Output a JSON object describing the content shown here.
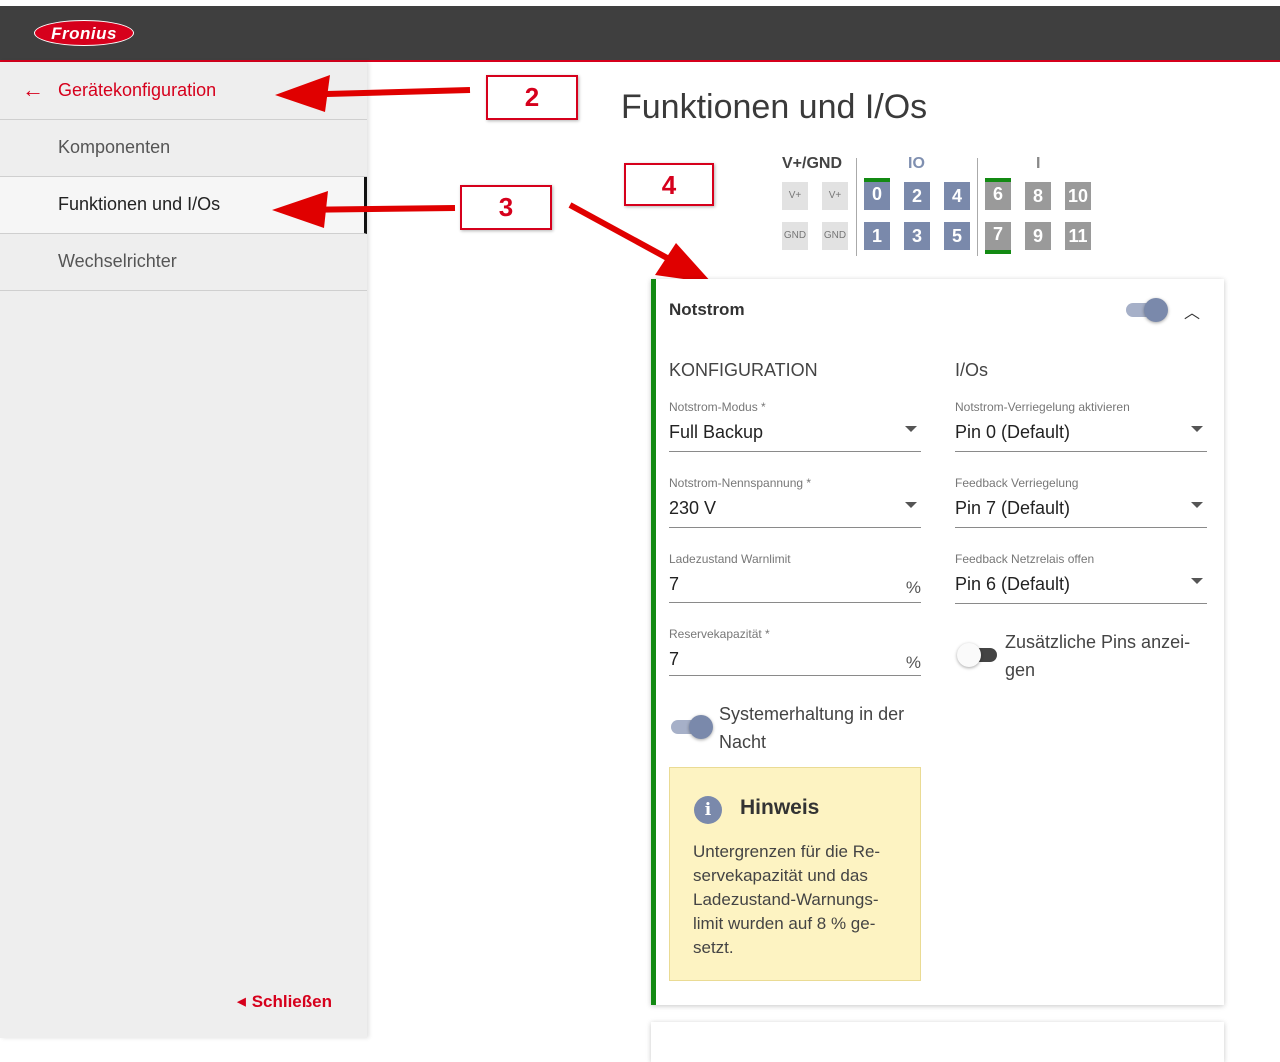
{
  "header": {
    "logo_text": "Fronius"
  },
  "sidebar": {
    "back_label": "Gerätekonfiguration",
    "items": [
      {
        "label": "Komponenten"
      },
      {
        "label": "Funktionen und I/Os"
      },
      {
        "label": "Wechselrichter"
      }
    ],
    "close_label": "Schließen"
  },
  "callouts": {
    "c2": "2",
    "c3": "3",
    "c4": "4"
  },
  "main": {
    "title": "Funktionen und I/Os",
    "pin_groups": {
      "power": "V+/GND",
      "io": "IO",
      "input": "I"
    },
    "pins_power_top": [
      "V+",
      "V+"
    ],
    "pins_power_bottom": [
      "GND",
      "GND"
    ],
    "pins_io_top": [
      "0",
      "2",
      "4"
    ],
    "pins_io_bottom": [
      "1",
      "3",
      "5"
    ],
    "pins_in_top": [
      "6",
      "8",
      "10"
    ],
    "pins_in_bottom": [
      "7",
      "9",
      "11"
    ]
  },
  "card": {
    "title": "Notstrom",
    "enabled": true,
    "config_heading": "KONFIGURATION",
    "io_heading": "I/Os",
    "fields": {
      "mode": {
        "label": "Notstrom-Modus *",
        "value": "Full Backup"
      },
      "voltage": {
        "label": "Notstrom-Nennspannung *",
        "value": "230 V"
      },
      "soc_warn": {
        "label": "Ladezustand Warnlimit",
        "value": "7",
        "unit": "%"
      },
      "reserve": {
        "label": "Reservekapazität *",
        "value": "7",
        "unit": "%"
      },
      "lock": {
        "label": "Notstrom-Verriegelung aktivieren",
        "value": "Pin 0 (Default)"
      },
      "feedback_lock": {
        "label": "Feedback Verriegelung",
        "value": "Pin 7 (Default)"
      },
      "feedback_relay": {
        "label": "Feedback Netzrelais offen",
        "value": "Pin 6 (Default)"
      }
    },
    "extra_pins_label_1": "Zusätzliche Pins anzei-",
    "extra_pins_label_2": "gen",
    "night_label_1": "Systemerhaltung in der",
    "night_label_2": "Nacht",
    "hint": {
      "title": "Hinweis",
      "lines": [
        "Untergrenzen für die Re-",
        "servekapazität und das",
        "Ladezustand-Warnungs-",
        "limit wurden auf 8 % ge-",
        "setzt."
      ]
    }
  },
  "colors": {
    "brand_red": "#d6001c",
    "active_green": "#138a13",
    "io_blue": "#7a89ab",
    "hint_yellow": "#fdf3c2"
  }
}
